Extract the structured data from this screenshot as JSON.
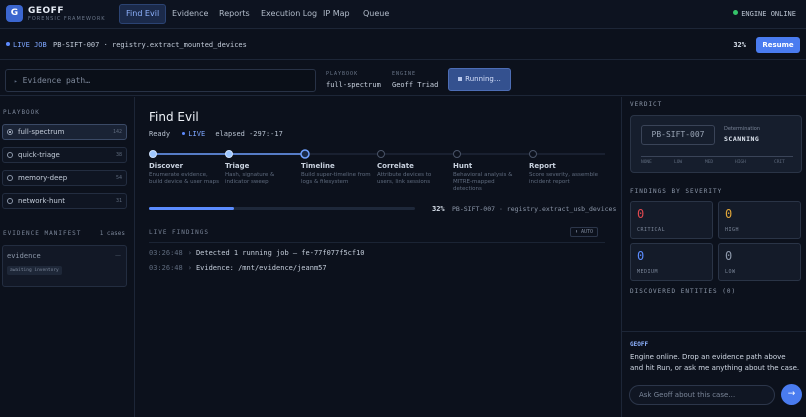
{
  "app": {
    "logo_letter": "G",
    "name": "GEOFF",
    "subtitle": "FORENSIC FRAMEWORK"
  },
  "nav": {
    "tabs": [
      {
        "label": "Find Evil",
        "active": true
      },
      {
        "label": "Evidence",
        "active": false
      },
      {
        "label": "Reports",
        "active": false
      },
      {
        "label": "Execution Log",
        "active": false
      },
      {
        "label": "IP Map",
        "active": false
      },
      {
        "label": "Queue",
        "active": false
      }
    ],
    "engine_status": "ENGINE ONLINE"
  },
  "job_bar": {
    "live_label": "LIVE JOB",
    "job_text": "PB-SIFT-007 · registry.extract_mounted_devices",
    "percent": "32%",
    "resume_label": "Resume"
  },
  "input_row": {
    "evidence_placeholder": "Evidence path…",
    "playbook_label": "PLAYBOOK",
    "playbook_value": "full-spectrum",
    "engine_label": "ENGINE",
    "engine_value": "Geoff Triad",
    "running_label": "Running…"
  },
  "sidebar": {
    "playbook_heading": "PLAYBOOK",
    "playbooks": [
      {
        "name": "full-spectrum",
        "count": "142",
        "selected": true
      },
      {
        "name": "quick-triage",
        "count": "38",
        "selected": false
      },
      {
        "name": "memory-deep",
        "count": "54",
        "selected": false
      },
      {
        "name": "network-hunt",
        "count": "31",
        "selected": false
      }
    ],
    "manifest_heading": "EVIDENCE MANIFEST",
    "manifest_count": "1 cases",
    "manifest_item": {
      "name": "evidence",
      "dash": "—",
      "tag": "awaiting inventory"
    }
  },
  "main": {
    "title": "Find Evil",
    "status": "Ready",
    "live": "LIVE",
    "elapsed": "elapsed -297:-17",
    "stages": [
      {
        "name": "Discover",
        "desc": "Enumerate evidence, build device & user maps",
        "state": "done"
      },
      {
        "name": "Triage",
        "desc": "Hash, signature & indicator sweep",
        "state": "done"
      },
      {
        "name": "Timeline",
        "desc": "Build super-timeline from logs & filesystem",
        "state": "active"
      },
      {
        "name": "Correlate",
        "desc": "Attribute devices to users, link sessions",
        "state": "pending"
      },
      {
        "name": "Hunt",
        "desc": "Behavioral analysis & MITRE-mapped detections",
        "state": "pending"
      },
      {
        "name": "Report",
        "desc": "Score severity, assemble incident report",
        "state": "pending"
      }
    ],
    "progress": 0.32,
    "progress_label": "32%",
    "progress_job": "PB-SIFT-007 · registry.extract_usb_devices",
    "findings_heading": "LIVE FINDINGS",
    "auto_label": "⬇ AUTO",
    "log": [
      {
        "time": "03:26:48",
        "text": "Detected 1 running job — fe-77f077f5cf10"
      },
      {
        "time": "03:26:48",
        "text": "Evidence: /mnt/evidence/jeanm57"
      }
    ]
  },
  "right": {
    "verdict_heading": "VERDICT",
    "verdict_id": "PB-SIFT-007",
    "determination_label": "Determination",
    "determination_value": "SCANNING",
    "severity_scale": [
      "NONE",
      "LOW",
      "MED",
      "HIGH",
      "CRIT"
    ],
    "findings_heading": "FINDINGS BY SEVERITY",
    "severity": [
      {
        "label": "CRITICAL",
        "value": "0",
        "color": "#e0484f"
      },
      {
        "label": "HIGH",
        "value": "0",
        "color": "#e0a63a"
      },
      {
        "label": "MEDIUM",
        "value": "0",
        "color": "#5b8cff"
      },
      {
        "label": "LOW",
        "value": "0",
        "color": "#8d98aa"
      }
    ],
    "entities_heading": "DISCOVERED ENTITIES (0)",
    "chat_sender": "GEOFF",
    "chat_message": "Engine online. Drop an evidence path above and hit Run, or ask me anything about the case.",
    "chat_placeholder": "Ask Geoff about this case…",
    "send_icon": "→"
  }
}
